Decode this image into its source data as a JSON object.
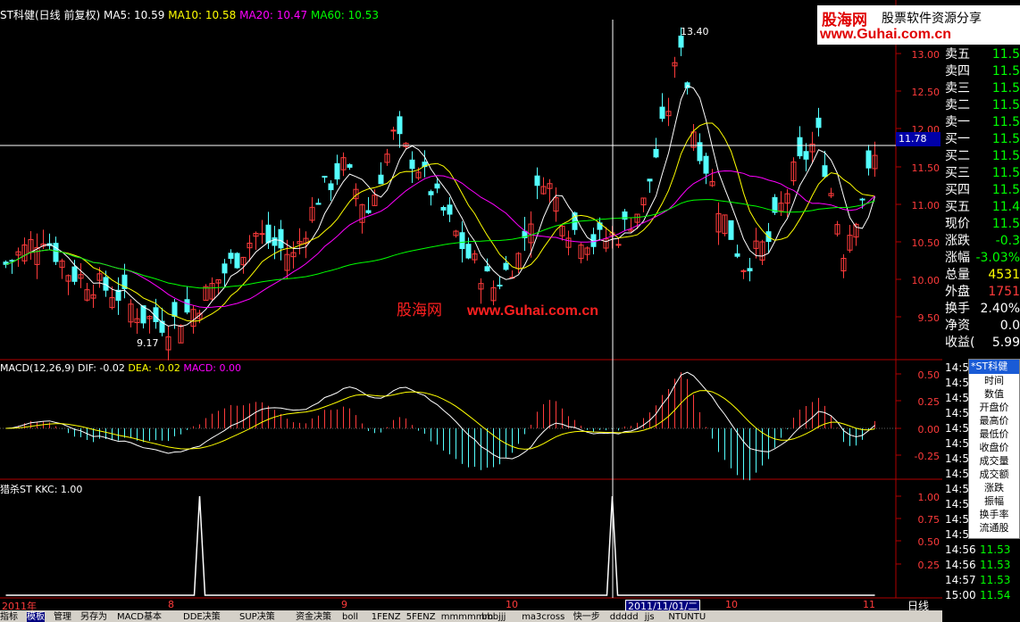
{
  "main_info": {
    "title": "ST科健(日线 前复权)",
    "ma5": "MA5: 10.59",
    "ma10": "MA10: 10.58",
    "ma20": "MA20: 10.47",
    "ma60": "MA60: 10.53"
  },
  "price_axis": [
    "13.00",
    "12.50",
    "12.00",
    "11.50",
    "11.00",
    "10.50",
    "10.00",
    "9.50"
  ],
  "current_price_tag": "11.78",
  "annotations": {
    "high": "13.40",
    "low": "9.17"
  },
  "macd_info": {
    "name": "MACD(12,26,9)",
    "dif": "DIF: -0.02",
    "dea": "DEA: -0.02",
    "macd": "MACD: 0.00"
  },
  "macd_axis": [
    "0.50",
    "0.25",
    "0.00",
    "-0.25"
  ],
  "kkc_info": {
    "name": "猎杀ST",
    "value": "KKC: 1.00"
  },
  "kkc_axis": [
    "1.00",
    "0.75",
    "0.50",
    "0.25"
  ],
  "x_axis": [
    "2011年",
    "8",
    "9",
    "10",
    "10",
    "11"
  ],
  "cursor_date": "2011/11/01/二",
  "period_label": "日线",
  "quotes": [
    {
      "label": "卖五",
      "value": "11.5"
    },
    {
      "label": "卖四",
      "value": "11.5"
    },
    {
      "label": "卖三",
      "value": "11.5"
    },
    {
      "label": "卖二",
      "value": "11.5"
    },
    {
      "label": "卖一",
      "value": "11.5"
    },
    {
      "label": "买一",
      "value": "11.5"
    },
    {
      "label": "买二",
      "value": "11.5"
    },
    {
      "label": "买三",
      "value": "11.5"
    },
    {
      "label": "买四",
      "value": "11.5"
    },
    {
      "label": "买五",
      "value": "11.4"
    },
    {
      "label": "现价",
      "value": "11.5"
    },
    {
      "label": "涨跌",
      "value": "-0.3"
    },
    {
      "label": "涨幅",
      "value": "-3.03%"
    },
    {
      "label": "总量",
      "value": "4531"
    },
    {
      "label": "外盘",
      "value": "1751"
    },
    {
      "label": "换手",
      "value": "2.40%"
    },
    {
      "label": "净资",
      "value": "0.0"
    },
    {
      "label": "收益(",
      "value": "5.99"
    }
  ],
  "ticks": [
    {
      "time": "14:5",
      "value": ""
    },
    {
      "time": "14:5",
      "value": ""
    },
    {
      "time": "14:5",
      "value": ""
    },
    {
      "time": "14:5",
      "value": ""
    },
    {
      "time": "14:5",
      "value": ""
    },
    {
      "time": "14:5",
      "value": ""
    },
    {
      "time": "14:5",
      "value": ""
    },
    {
      "time": "14:5",
      "value": ""
    },
    {
      "time": "14:5",
      "value": ""
    },
    {
      "time": "14:5",
      "value": ""
    },
    {
      "time": "14:5",
      "value": ""
    },
    {
      "time": "14:56",
      "value": "11.54"
    },
    {
      "time": "14:56",
      "value": "11.53"
    },
    {
      "time": "14:56",
      "value": "11.53"
    },
    {
      "time": "14:57",
      "value": "11.53"
    },
    {
      "time": "15:00",
      "value": "11.54"
    }
  ],
  "popup": {
    "title": "*ST科健",
    "items": [
      "时间",
      "数值",
      "开盘价",
      "最高价",
      "最低价",
      "收盘价",
      "成交量",
      "成交额",
      "涨跌",
      "振幅",
      "换手率",
      "流通股"
    ]
  },
  "tabs": [
    "指标",
    "模板",
    "管理",
    "另存为",
    "MACD基本",
    "DDE决策",
    "SUP决策",
    "资金决策",
    "boll",
    "1FENZ",
    "5FENZ",
    "mmmmmm",
    "bbbjjj",
    "ma3cross",
    "快一步",
    "ddddd",
    "jjs",
    "NTUNTU"
  ],
  "logo": {
    "name": "股海网",
    "slogan": "股票软件资源分享",
    "url": "www.Guhai.com.cn"
  },
  "watermark": {
    "name": "股海网",
    "url": "www.Guhai.com.cn"
  },
  "colors": {
    "up": "#ff3b3b",
    "down": "#54ffff",
    "ma5": "#ffffff",
    "ma10": "#ffff00",
    "ma20": "#ff00ff",
    "ma60": "#00ff00",
    "axis": "#b00000"
  }
}
